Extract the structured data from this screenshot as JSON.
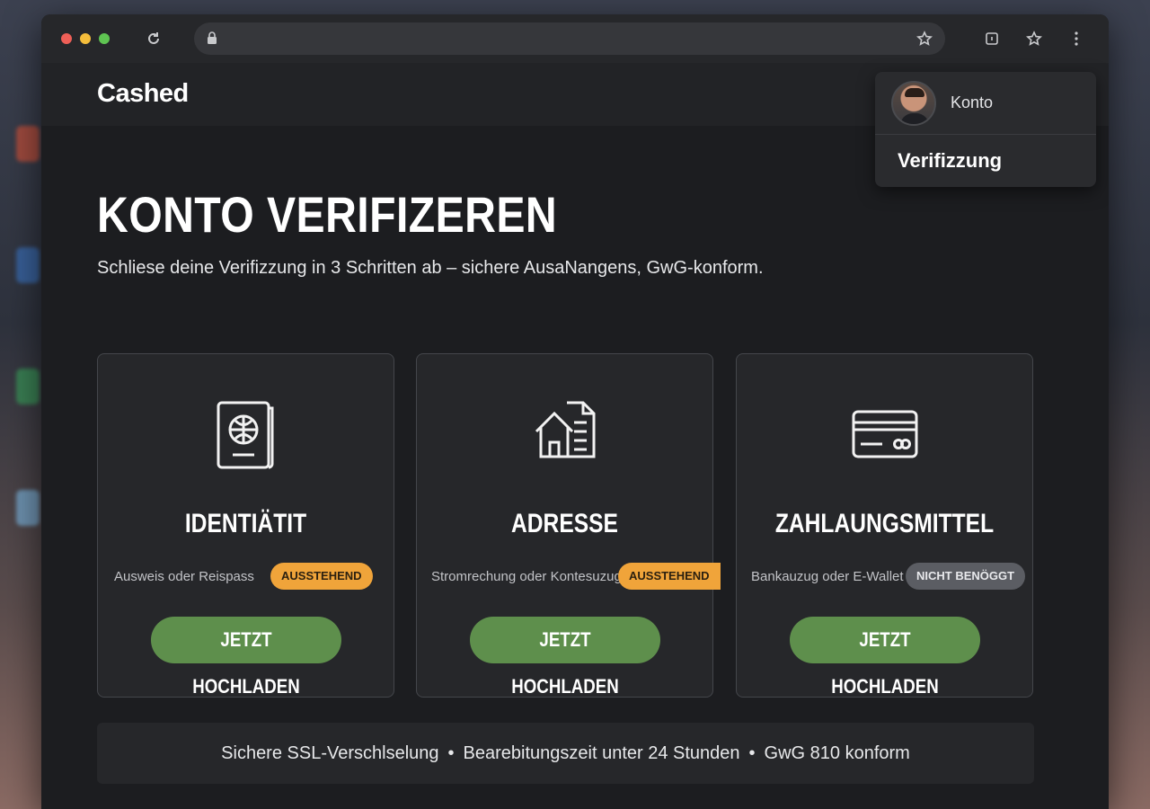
{
  "brand": {
    "logo": "Cashed"
  },
  "account_menu": {
    "label": "Konto",
    "items": [
      "Verifizzung"
    ]
  },
  "hero": {
    "title": "KONTO VERIFIZEREN",
    "subtitle": "Schliese deine Verifizzung in 3 Schritten ab – sichere AusaNangens, GwG-konform."
  },
  "cards": [
    {
      "icon": "passport-icon",
      "title": "IDENTIÄTIT",
      "description": "Ausweis oder Reispass",
      "status": "AUSSTEHEND",
      "button": "JETZT HOCHLADEN"
    },
    {
      "icon": "house-document-icon",
      "title": "ADRESSE",
      "description": "Stromrechung oder Kontesuzug",
      "status": "AUSSTEHEND",
      "button": "JETZT HOCHLADEN"
    },
    {
      "icon": "credit-card-icon",
      "title": "ZAHLAUNGSMITTEL",
      "description": "Bankauzug oder E-Wallet",
      "status": "NICHT BENÖGGT",
      "button": "JETZT HOCHLADEN"
    }
  ],
  "footer": {
    "items": [
      "Sichere SSL-Verschlselung",
      "Bearebitungszeit unter 24 Stunden",
      "GwG 810 konform"
    ],
    "separator": "•"
  },
  "colors": {
    "accent_green": "#5e8f4c",
    "status_pending": "#f0a43a",
    "status_neutral": "#5b5d63",
    "background": "#1c1d20"
  }
}
